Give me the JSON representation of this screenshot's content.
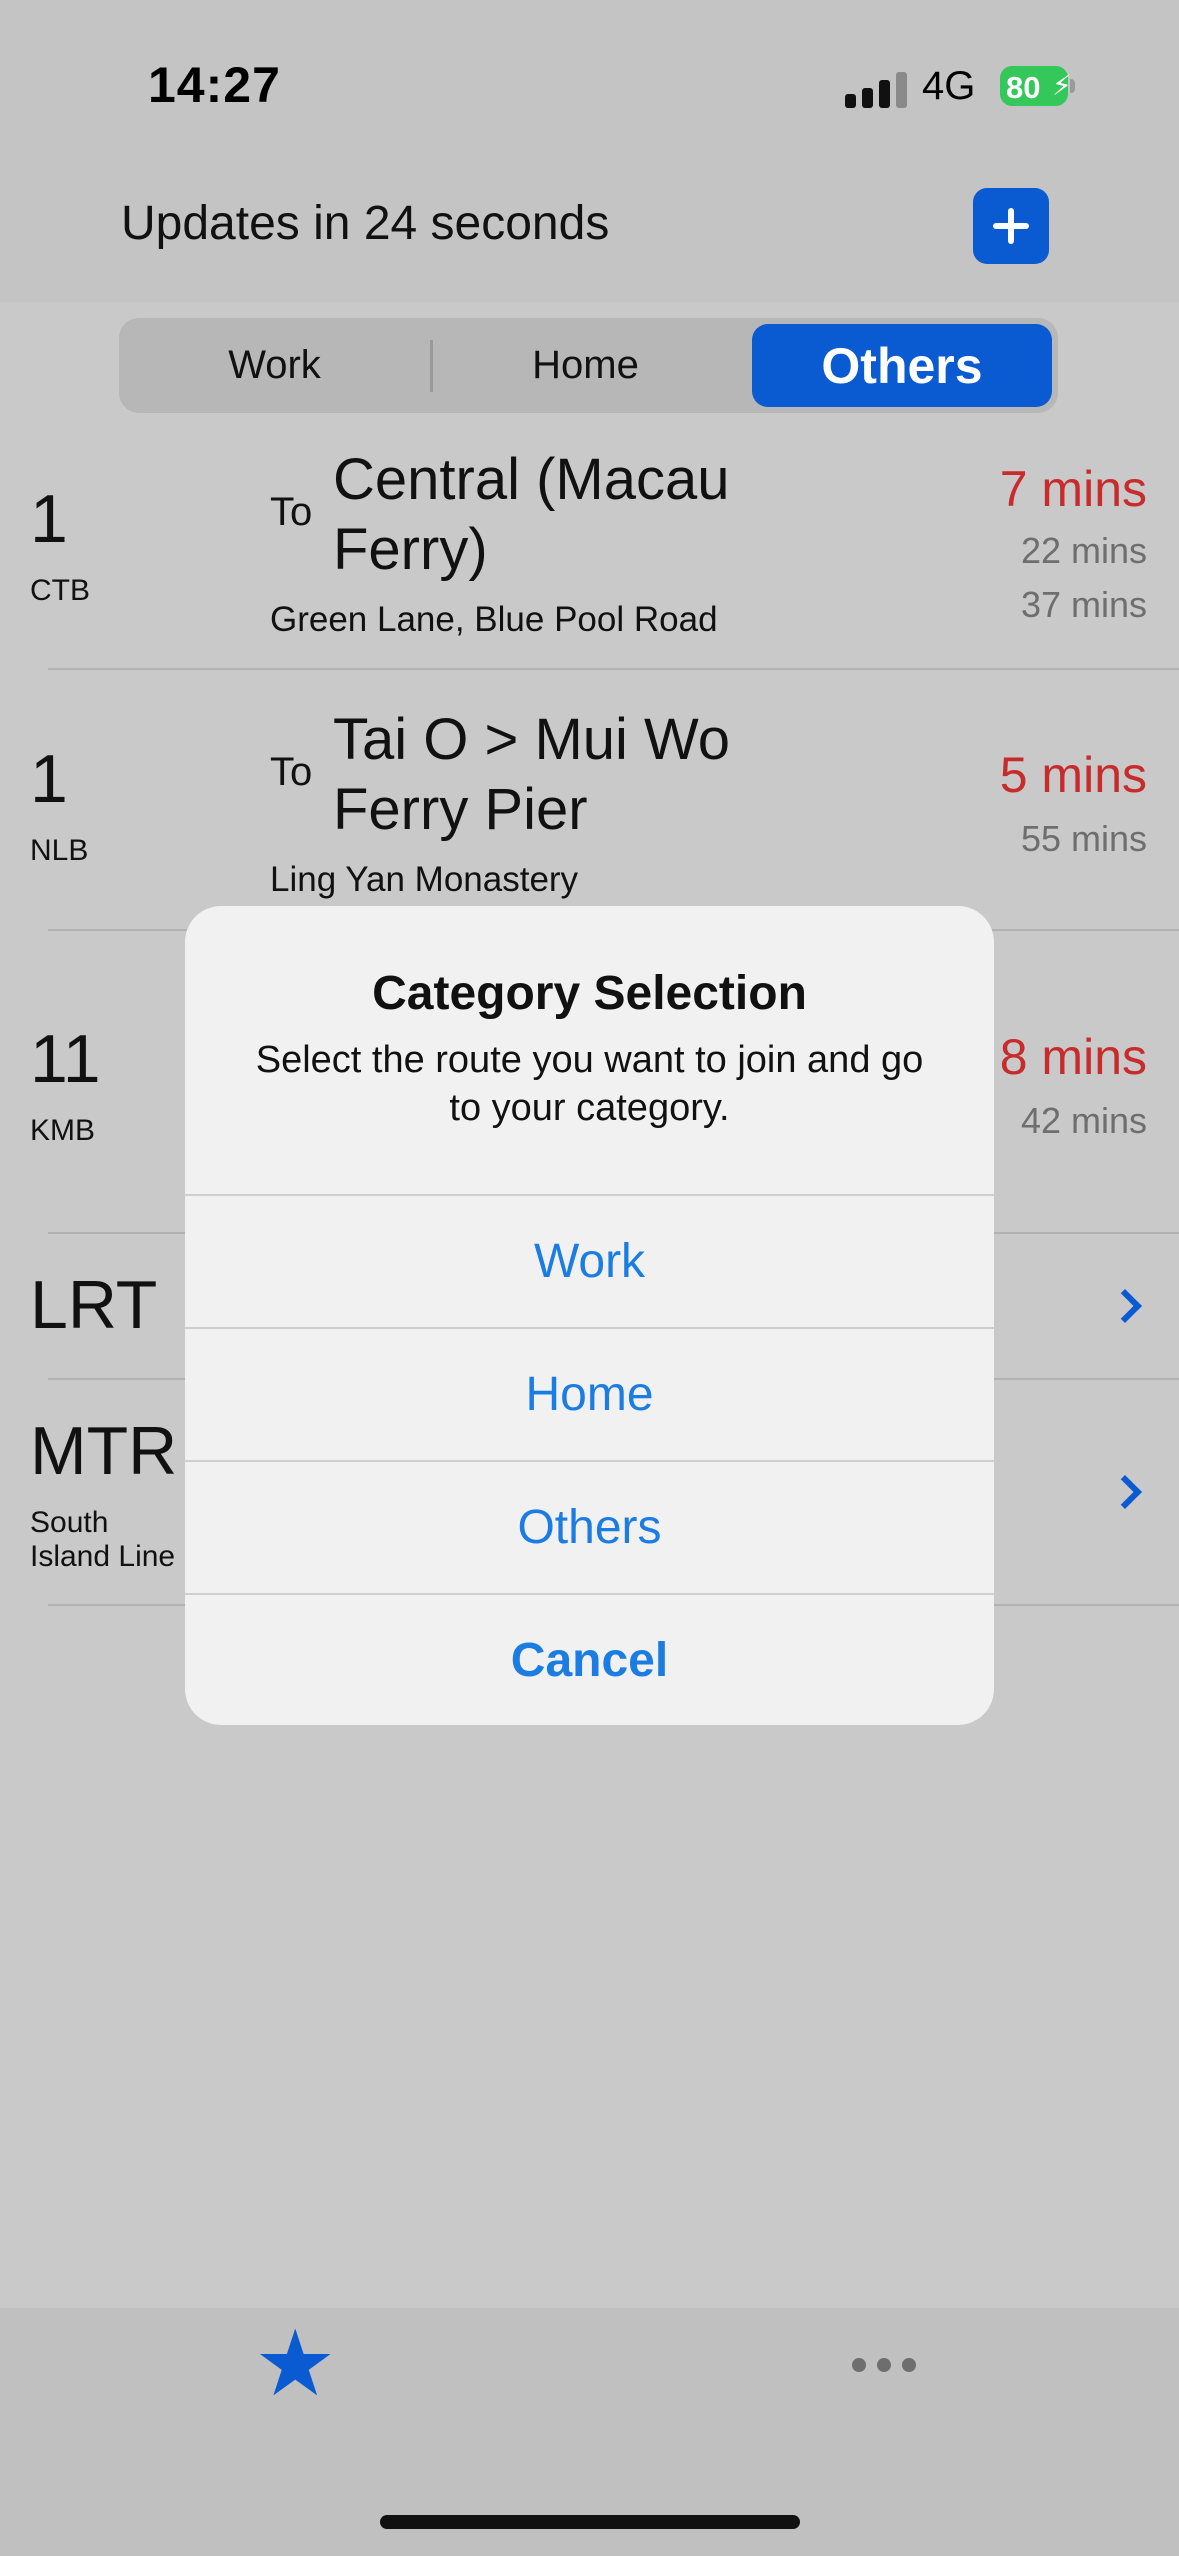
{
  "status_bar": {
    "time": "14:27",
    "network": "4G",
    "battery": "80"
  },
  "header": {
    "updates_text": "Updates in 24 seconds",
    "add_icon": "plus-icon"
  },
  "segments": {
    "work": "Work",
    "home": "Home",
    "others": "Others",
    "selected": "Others"
  },
  "routes": [
    {
      "number": "1",
      "company": "CTB",
      "to": "To",
      "destination": "Central (Macau Ferry)",
      "stop": "Green Lane, Blue Pool Road",
      "eta": [
        "7 mins",
        "22 mins",
        "37 mins"
      ]
    },
    {
      "number": "1",
      "company": "NLB",
      "to": "To",
      "destination": "Tai O > Mui Wo Ferry Pier",
      "stop": "Ling Yan Monastery",
      "eta": [
        "5 mins",
        "55 mins"
      ]
    },
    {
      "number": "11",
      "company": "KMB",
      "eta": [
        "8 mins",
        "42 mins"
      ]
    }
  ],
  "rail": [
    {
      "label": "LRT"
    },
    {
      "label": "MTR",
      "sub": "South Island Line"
    }
  ],
  "alert": {
    "title": "Category Selection",
    "message": "Select the route you want to join and go to your category.",
    "buttons": [
      "Work",
      "Home",
      "Others",
      "Cancel"
    ]
  },
  "tabbar": {
    "favorites_icon": "star-icon",
    "more_icon": "more-icon"
  },
  "colors": {
    "accent": "#0a5bd1",
    "eta_red": "#c72b2b",
    "alert_link": "#1b7ce2"
  }
}
